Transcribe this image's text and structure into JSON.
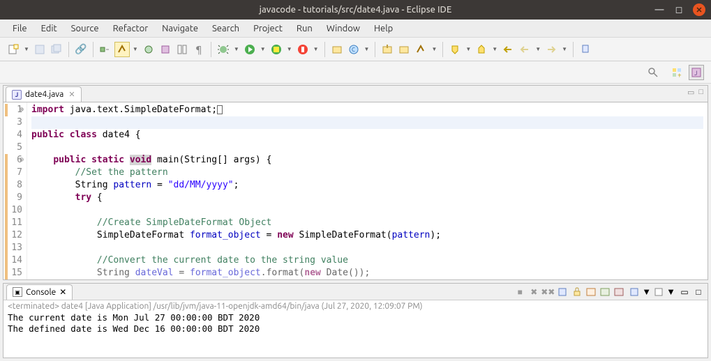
{
  "window": {
    "title": "javacode - tutorials/src/date4.java - Eclipse IDE"
  },
  "menu": {
    "file": "File",
    "edit": "Edit",
    "source": "Source",
    "refactor": "Refactor",
    "navigate": "Navigate",
    "search": "Search",
    "project": "Project",
    "run": "Run",
    "window": "Window",
    "help": "Help"
  },
  "editor": {
    "tab_name": "date4.java",
    "lines": {
      "1": {
        "num": "1",
        "prefix": "import",
        "rest": " java.text.SimpleDateFormat;"
      },
      "3": {
        "num": "3"
      },
      "4": {
        "num": "4",
        "kw1": "public",
        "kw2": "class",
        "name": " date4 {"
      },
      "5": {
        "num": "5"
      },
      "6": {
        "num": "6",
        "indent": "    ",
        "kw1": "public",
        "kw2": "static",
        "kw3": "void",
        "rest": " main(String[] args) {"
      },
      "7": {
        "num": "7",
        "indent": "        ",
        "cmt": "//Set the pattern"
      },
      "8": {
        "num": "8",
        "indent": "        ",
        "p1": "String ",
        "var": "pattern",
        "p2": " = ",
        "str": "\"dd/MM/yyyy\"",
        "p3": ";"
      },
      "9": {
        "num": "9",
        "indent": "        ",
        "kw": "try",
        "rest": " {"
      },
      "10": {
        "num": "10"
      },
      "11": {
        "num": "11",
        "indent": "            ",
        "cmt": "//Create SimpleDateFormat Object"
      },
      "12": {
        "num": "12",
        "indent": "            ",
        "p1": "SimpleDateFormat ",
        "var": "format_object",
        "p2": " = ",
        "kw": "new",
        "p3": " SimpleDateFormat(",
        "arg": "pattern",
        "p4": ");"
      },
      "13": {
        "num": "13"
      },
      "14": {
        "num": "14",
        "indent": "            ",
        "cmt": "//Convert the current date to the string value"
      },
      "15": {
        "num": "15",
        "indent": "            ",
        "p1": "String ",
        "var": "dateVal",
        "p2": " = ",
        "obj": "format_object",
        "p3": ".format(",
        "kw": "new",
        "p4": " Date());"
      }
    }
  },
  "console": {
    "tab_name": "Console",
    "header": "<terminated> date4 [Java Application] /usr/lib/jvm/java-11-openjdk-amd64/bin/java (Jul 27, 2020, 12:09:07 PM)",
    "line1": "The current date is Mon Jul 27 00:00:00 BDT 2020",
    "line2": "The defined date is Wed Dec 16 00:00:00 BDT 2020"
  }
}
